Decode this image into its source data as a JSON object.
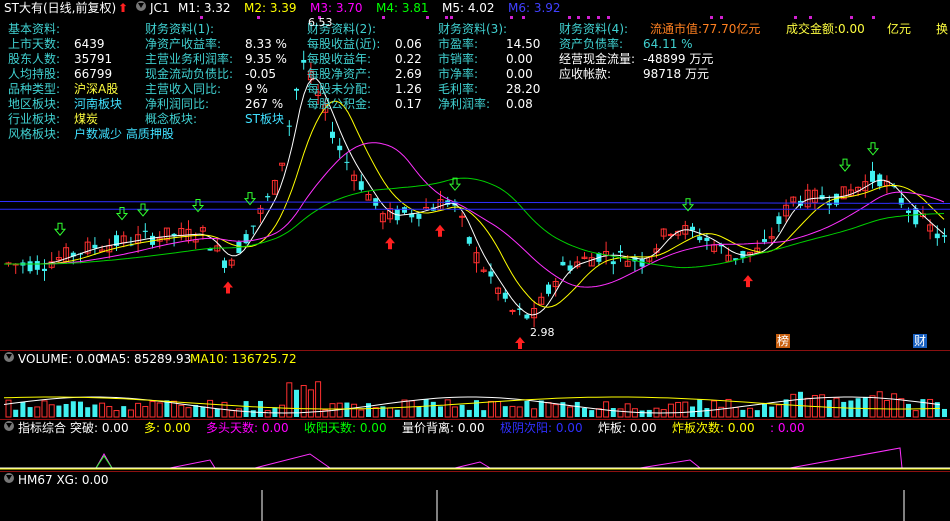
{
  "header": {
    "title": "ST大有(日线,前复权)",
    "indicator": "JC1",
    "ma": [
      {
        "label": "M1: 3.32",
        "color": "#ffffff"
      },
      {
        "label": "M2: 3.39",
        "color": "#ffff00"
      },
      {
        "label": "M3: 3.70",
        "color": "#ff00ff"
      },
      {
        "label": "M4: 3.81",
        "color": "#00ff00"
      },
      {
        "label": "M5: 4.02",
        "color": "#ffffff"
      },
      {
        "label": "M6: 3.92",
        "color": "#4040ff"
      }
    ]
  },
  "fin": {
    "col1": [
      {
        "label": "基本资料:",
        "value": ""
      },
      {
        "label": "上市天数:",
        "value": "6439"
      },
      {
        "label": "股东人数:",
        "value": "35791"
      },
      {
        "label": "人均持股:",
        "value": "66799"
      },
      {
        "label": "品种类型:",
        "value": "沪深A股"
      },
      {
        "label": "地区板块:",
        "value": "河南板块"
      },
      {
        "label": "行业板块:",
        "value": "煤炭"
      },
      {
        "label": "风格板块:",
        "value": "户数减少 高质押股"
      }
    ],
    "col2": [
      {
        "label": "财务资料(1):",
        "value": ""
      },
      {
        "label": "净资产收益率:",
        "value": "8.33 %"
      },
      {
        "label": "主营业务利润率:",
        "value": "9.35 %"
      },
      {
        "label": "现金流动负债比:",
        "value": "-0.05"
      },
      {
        "label": "主营收入同比:",
        "value": "9 %"
      },
      {
        "label": "净利润同比:",
        "value": "267 %"
      },
      {
        "label": "概念板块:",
        "value": "ST板块"
      }
    ],
    "col3": [
      {
        "label": "财务资料(2):",
        "value": ""
      },
      {
        "label": "每股收益(近):",
        "value": "0.06"
      },
      {
        "label": "每股收益年:",
        "value": "0.22"
      },
      {
        "label": "每股净资产:",
        "value": "2.69"
      },
      {
        "label": "每股未分配:",
        "value": "1.26"
      },
      {
        "label": "每股公积金:",
        "value": "0.17"
      }
    ],
    "col4": [
      {
        "label": "财务资料(3):",
        "value": ""
      },
      {
        "label": "市盈率:",
        "value": "14.50"
      },
      {
        "label": "市销率:",
        "value": "0.00"
      },
      {
        "label": "市净率:",
        "value": "0.00"
      },
      {
        "label": "毛利率:",
        "value": "28.20"
      },
      {
        "label": "净利润率:",
        "value": "0.08"
      }
    ],
    "col5": [
      {
        "label": "财务资料(4):",
        "value": ""
      },
      {
        "label": "资产负债率:",
        "value": "64.11 %"
      },
      {
        "label": "经营现金流量:",
        "value": "-48899 万元"
      },
      {
        "label": "应收帐款:",
        "value": "98718 万元"
      }
    ],
    "market": {
      "label": "流通市值:",
      "value": "77.70亿元"
    },
    "amount": {
      "label": "成交金额:",
      "value": "0.00"
    },
    "amount_unit": "亿元",
    "extra": "换"
  },
  "chart": {
    "high_label": "6.53",
    "low_label": "2.98",
    "badges": [
      {
        "text": "榜"
      },
      {
        "text": "财"
      }
    ]
  },
  "volume": {
    "title": "VOLUME: 0.00",
    "ma5": "MA5: 85289.93",
    "ma10": "MA10: 136725.72"
  },
  "ind": {
    "name": "指标综合",
    "items": [
      {
        "label": "突破: 0.00",
        "color": "#ffffff"
      },
      {
        "label": "多: 0.00",
        "color": "#ffff00"
      },
      {
        "label": "多头天数: 0.00",
        "color": "#ff00ff"
      },
      {
        "label": "收阳天数: 0.00",
        "color": "#00ff00"
      },
      {
        "label": "量价背离: 0.00",
        "color": "#ffffff"
      },
      {
        "label": "极阴次阳: 0.00",
        "color": "#3030ff"
      },
      {
        "label": "炸板: 0.00",
        "color": "#ffffff"
      },
      {
        "label": "炸板次数: 0.00",
        "color": "#ffff00"
      },
      {
        "label": ": 0.00",
        "color": "#ff00ff"
      }
    ]
  },
  "hm": {
    "title": "HM67  XG: 0.00"
  },
  "colors": {
    "up": "#ff3030",
    "down": "#40f0f0",
    "label": "#40d0d0",
    "value": "#ffffff",
    "market": "#ff8020",
    "amount": "#ffff40"
  }
}
